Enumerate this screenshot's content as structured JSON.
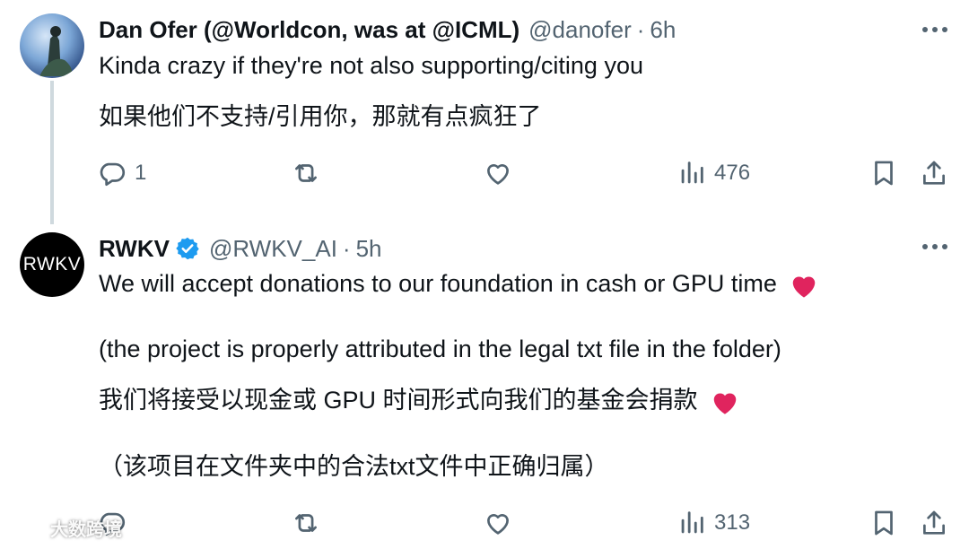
{
  "tweet1": {
    "name": "Dan Ofer (@Worldcon, was at @ICML)",
    "handle": "@danofer",
    "separator": "·",
    "time": "6h",
    "text_en": "Kinda crazy if they're not also supporting/citing you",
    "text_zh": "如果他们不支持/引用你，那就有点疯狂了",
    "replies": "1",
    "views": "476"
  },
  "tweet2": {
    "avatar_text": "RWKV",
    "name": "RWKV",
    "handle": "@RWKV_AI",
    "separator": "·",
    "time": "5h",
    "text_en_1": "We will accept donations to our foundation in cash or GPU time",
    "text_en_2": "(the project is properly attributed in the legal txt file in the folder)",
    "text_zh_1": "我们将接受以现金或 GPU 时间形式向我们的基金会捐款",
    "text_zh_2": "（该项目在文件夹中的合法txt文件中正确归属）",
    "views": "313"
  },
  "watermark": "大数跨境",
  "colors": {
    "text": "#0f1419",
    "muted": "#536471",
    "verified": "#1d9bf0",
    "heart": "#e0245e",
    "thread": "#cfd9de"
  },
  "icons": [
    "reply-icon",
    "retweet-icon",
    "like-icon",
    "views-icon",
    "bookmark-icon",
    "share-icon",
    "more-icon",
    "verified-badge-icon",
    "heart-emoji-icon"
  ]
}
